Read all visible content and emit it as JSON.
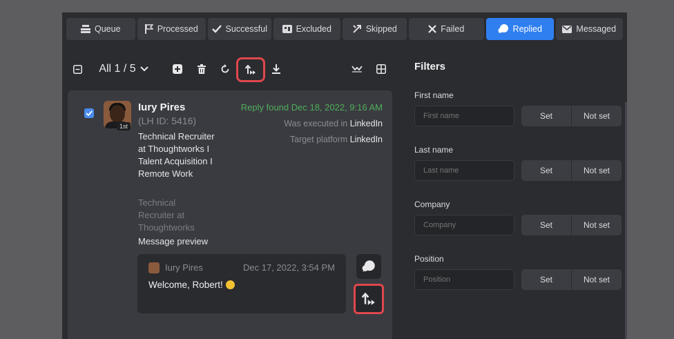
{
  "tabs": [
    {
      "label": "Queue",
      "icon": "queue-icon",
      "active": false
    },
    {
      "label": "Processed",
      "icon": "flag-icon",
      "active": false
    },
    {
      "label": "Successful",
      "icon": "check-icon",
      "active": false
    },
    {
      "label": "Excluded",
      "icon": "excluded-icon",
      "active": false
    },
    {
      "label": "Skipped",
      "icon": "skip-icon",
      "active": false
    },
    {
      "label": "Failed",
      "icon": "x-icon",
      "active": false
    },
    {
      "label": "Replied",
      "icon": "reply-bubble-icon",
      "active": true
    },
    {
      "label": "Messaged",
      "icon": "envelope-icon",
      "active": false
    }
  ],
  "toolbar": {
    "selector_label": "All 1 / 5",
    "icons": [
      "collapse-icon",
      "add-icon",
      "trash-icon",
      "refresh-icon",
      "retry-icon",
      "download-icon",
      "funnel-chart-icon",
      "grid-icon"
    ]
  },
  "card": {
    "checked": true,
    "name": "Iury Pires",
    "lh_id": "(LH ID: 5416)",
    "connection_badge": "1st",
    "headline": "Technical Recruiter at Thoughtworks I Talent Acquisition I Remote Work",
    "company_position": "Technical Recruiter at Thoughtworks",
    "reply_status": "Reply found Dec 18, 2022, 9:16 AM",
    "executed_prefix": "Was executed in",
    "executed_platform": "LinkedIn",
    "target_prefix": "Target platform",
    "target_platform": "LinkedIn",
    "preview_label": "Message preview",
    "message": {
      "sender": "Iury Pires",
      "date": "Dec 17, 2022, 3:54 PM",
      "text": "Welcome, Robert!"
    }
  },
  "filters": {
    "title": "Filters",
    "fields": [
      {
        "label": "First name",
        "placeholder": "First name",
        "set": "Set",
        "not_set": "Not set"
      },
      {
        "label": "Last name",
        "placeholder": "Last name",
        "set": "Set",
        "not_set": "Not set"
      },
      {
        "label": "Company",
        "placeholder": "Company",
        "set": "Set",
        "not_set": "Not set"
      },
      {
        "label": "Position",
        "placeholder": "Position",
        "set": "Set",
        "not_set": "Not set"
      }
    ]
  },
  "colors": {
    "accent": "#2f7ff0",
    "highlight": "#e0474c",
    "reply_green": "#4fae5a"
  }
}
